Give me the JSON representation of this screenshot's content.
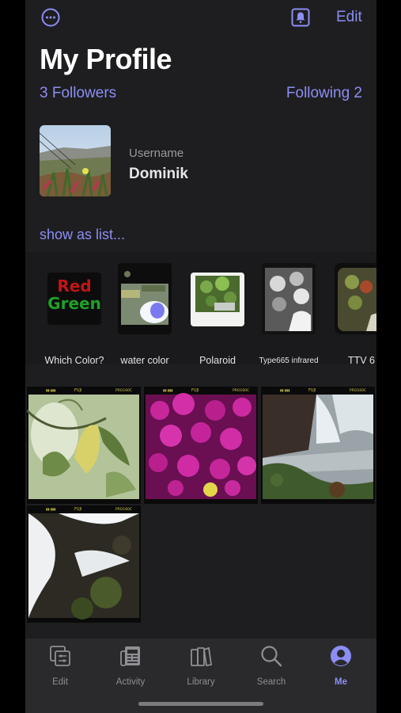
{
  "header": {
    "edit_label": "Edit"
  },
  "profile": {
    "title": "My Profile",
    "followers": "3 Followers",
    "following": "Following 2",
    "username_label": "Username",
    "username": "Dominik",
    "show_as_list": "show as list..."
  },
  "filters": [
    {
      "label": "Which Color?"
    },
    {
      "label": "water color"
    },
    {
      "label": "Polaroid"
    },
    {
      "label": "Type665 infrared"
    },
    {
      "label": "TTV 6"
    }
  ],
  "filter_thumb_text": {
    "line1": "Red",
    "line2": "Green"
  },
  "film_strip_text": {
    "brand": "FUJI",
    "stock": "PRO160C"
  },
  "tabs": [
    {
      "label": "Edit",
      "icon": "edit-icon"
    },
    {
      "label": "Activity",
      "icon": "activity-icon"
    },
    {
      "label": "Library",
      "icon": "library-icon"
    },
    {
      "label": "Search",
      "icon": "search-icon"
    },
    {
      "label": "Me",
      "icon": "person-icon",
      "active": true
    }
  ],
  "colors": {
    "accent": "#8c8df5",
    "background": "#1e1e20",
    "tabbar": "#2a2a2d"
  }
}
